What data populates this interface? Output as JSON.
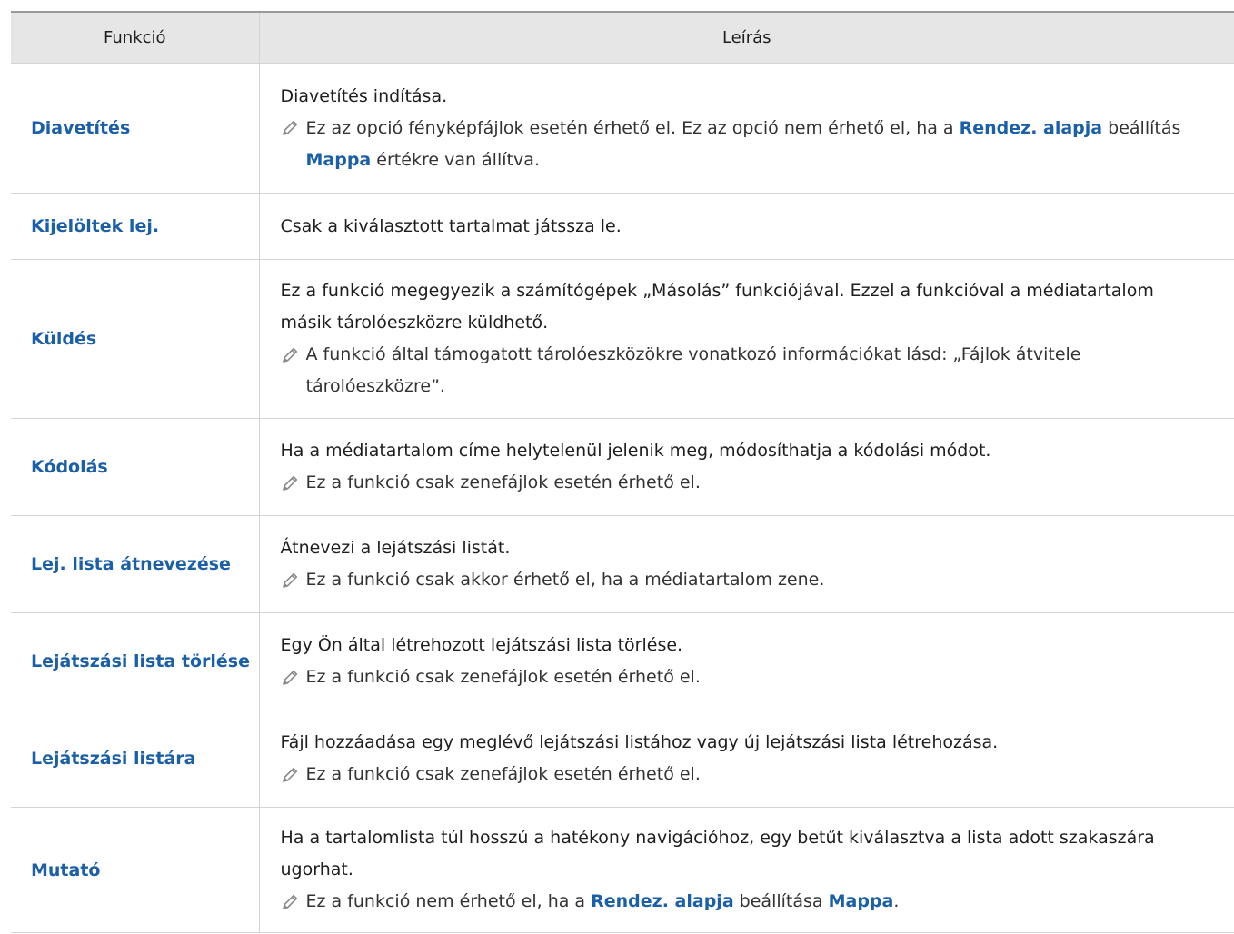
{
  "header": {
    "col1": "Funkció",
    "col2": "Leírás"
  },
  "rows": [
    {
      "name": "Diavetítés",
      "line1": "Diavetítés indítása.",
      "note": {
        "part1": "Ez az opció fényképfájlok esetén érhető el. Ez az opció nem érhető el, ha a ",
        "link1": "Rendez. alapja",
        "part2": " beállítás ",
        "link2": "Mappa",
        "part3": " értékre van állítva."
      }
    },
    {
      "name": "Kijelöltek lej.",
      "line1": "Csak a kiválasztott tartalmat játssza le."
    },
    {
      "name": "Küldés",
      "line1": "Ez a funkció megegyezik a számítógépek „Másolás” funkciójával. Ezzel a funkcióval a médiatartalom másik tárolóeszközre küldhető.",
      "note": "A funkció által támogatott tárolóeszközökre vonatkozó információkat lásd: „Fájlok átvitele tárolóeszközre”."
    },
    {
      "name": "Kódolás",
      "line1": "Ha a médiatartalom címe helytelenül jelenik meg, módosíthatja a kódolási módot.",
      "note": "Ez a funkció csak zenefájlok esetén érhető el."
    },
    {
      "name": "Lej. lista átnevezése",
      "line1": "Átnevezi a lejátszási listát.",
      "note": "Ez a funkció csak akkor érhető el, ha a médiatartalom zene."
    },
    {
      "name": "Lejátszási lista törlése",
      "line1": "Egy Ön által létrehozott lejátszási lista törlése.",
      "note": "Ez a funkció csak zenefájlok esetén érhető el."
    },
    {
      "name": "Lejátszási listára",
      "line1": "Fájl hozzáadása egy meglévő lejátszási listához vagy új lejátszási lista létrehozása.",
      "note": "Ez a funkció csak zenefájlok esetén érhető el."
    },
    {
      "name": "Mutató",
      "line1": "Ha a tartalomlista túl hosszú a hatékony navigációhoz, egy betűt kiválasztva a lista adott szakaszára ugorhat.",
      "note": {
        "part1": "Ez a funkció nem érhető el, ha a ",
        "link1": "Rendez. alapja",
        "part2": " beállítása ",
        "link2": "Mappa",
        "part3": "."
      }
    }
  ],
  "icons": {
    "note": "pencil-note-icon"
  },
  "colors": {
    "accent": "#1a5fa8",
    "header_bg": "#e6e6e6",
    "border": "#d4d4d4"
  }
}
